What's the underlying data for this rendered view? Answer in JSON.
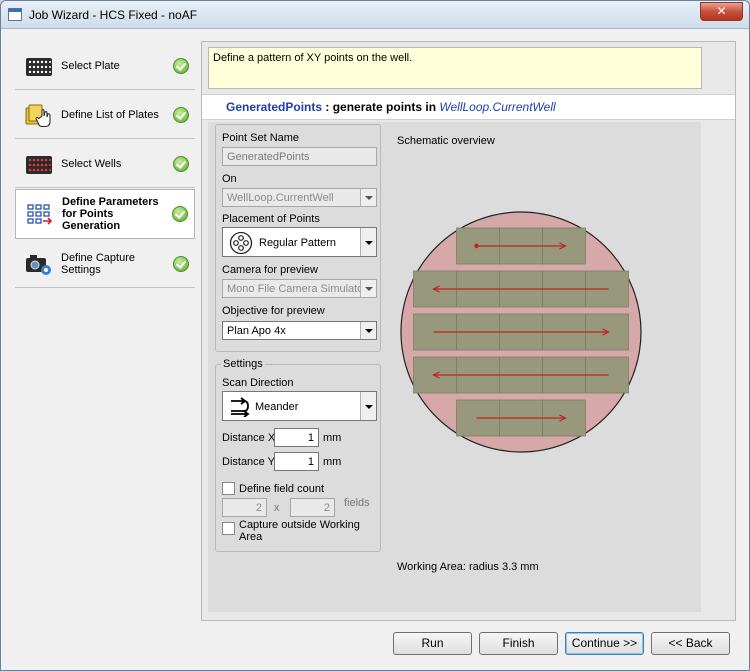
{
  "window": {
    "title": "Job Wizard - HCS Fixed - noAF",
    "close_label": "✕"
  },
  "steps": [
    {
      "label": "Select Plate",
      "icon": "plate-grid-icon",
      "done": true
    },
    {
      "label": "Define List of Plates",
      "icon": "plate-list-hand-icon",
      "done": true
    },
    {
      "label": "Select Wells",
      "icon": "wells-grid-icon",
      "done": true
    },
    {
      "label": "Define Parameters for Points Generation",
      "icon": "points-generation-icon",
      "done": true,
      "active": true
    },
    {
      "label": "Define Capture Settings",
      "icon": "camera-settings-icon",
      "done": true
    }
  ],
  "description": "Define a pattern of XY points on the well.",
  "command": {
    "name": "GeneratedPoints",
    "separator": " :  generate  points  in ",
    "target": "WellLoop.CurrentWell"
  },
  "form": {
    "point_set_name_label": "Point Set Name",
    "point_set_name_value": "GeneratedPoints",
    "on_label": "On",
    "on_value": "WellLoop.CurrentWell",
    "placement_label": "Placement of Points",
    "placement_value": "Regular Pattern",
    "camera_label": "Camera for preview",
    "camera_value": "Mono File Camera Simulator",
    "objective_label": "Objective for preview",
    "objective_value": "Plan Apo 4x"
  },
  "settings": {
    "group_title": "Settings",
    "scan_direction_label": "Scan Direction",
    "scan_direction_value": "Meander",
    "distance_x_label": "Distance X",
    "distance_x_value": "1",
    "distance_x_unit": "mm",
    "distance_y_label": "Distance Y",
    "distance_y_value": "1",
    "distance_y_unit": "mm",
    "field_count_label": "Define field count",
    "field_count_x": "2",
    "field_count_times": "x",
    "field_count_y": "2",
    "field_count_unit": "fields",
    "capture_outside_label": "Capture outside Working Area"
  },
  "preview": {
    "title": "Schematic overview",
    "working_area": "Working Area: radius 3.3 mm",
    "well_color": "#d7a8a8",
    "field_color": "#97987c",
    "arrow_color": "#c41e1e",
    "rows": [
      {
        "fields": 3,
        "direction": "right"
      },
      {
        "fields": 5,
        "direction": "left"
      },
      {
        "fields": 5,
        "direction": "right"
      },
      {
        "fields": 5,
        "direction": "left"
      },
      {
        "fields": 3,
        "direction": "right"
      }
    ]
  },
  "buttons": {
    "run": "Run",
    "finish": "Finish",
    "continue": "Continue >>",
    "back": "<< Back"
  }
}
